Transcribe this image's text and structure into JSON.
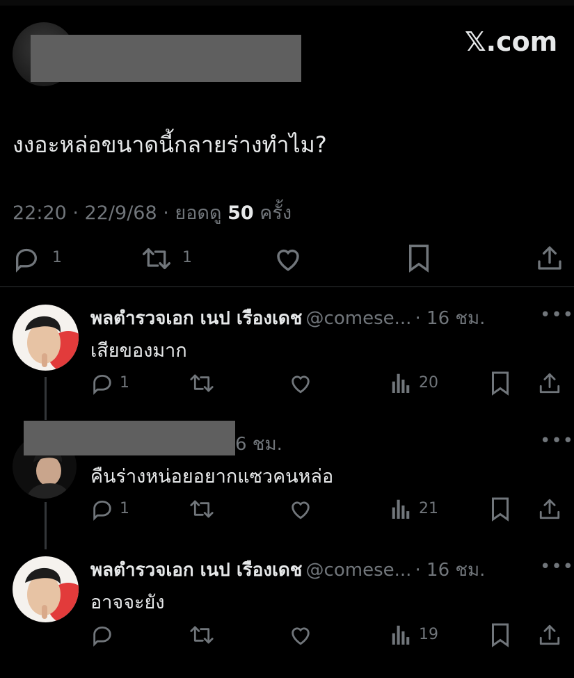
{
  "header": {
    "brand": "𝕏.com"
  },
  "main_tweet": {
    "text": "งงอะหล่อขนาดนี้กลายร่างทำไม?",
    "time_date": "22:20 · 22/9/68 · ยอดดู",
    "views": "50",
    "views_unit": "ครั้ง",
    "actions": {
      "reply_count": "1",
      "retweet_count": "1"
    }
  },
  "replies": [
    {
      "name": "พลตำรวจเอก เนป เรืองเดช",
      "handle": "@comese...",
      "time": "· 16 ชม.",
      "text": "เสียของมาก",
      "reply_count": "1",
      "views": "20"
    },
    {
      "time": "6 ชม.",
      "text": "คืนร่างหน่อยอยากแซวคนหล่อ",
      "reply_count": "1",
      "views": "21"
    },
    {
      "name": "พลตำรวจเอก เนป เรืองเดช",
      "handle": "@comese...",
      "time": "· 16 ชม.",
      "text": "อาจจะยัง",
      "reply_count": "",
      "views": "19"
    }
  ],
  "more_dots": "•••"
}
